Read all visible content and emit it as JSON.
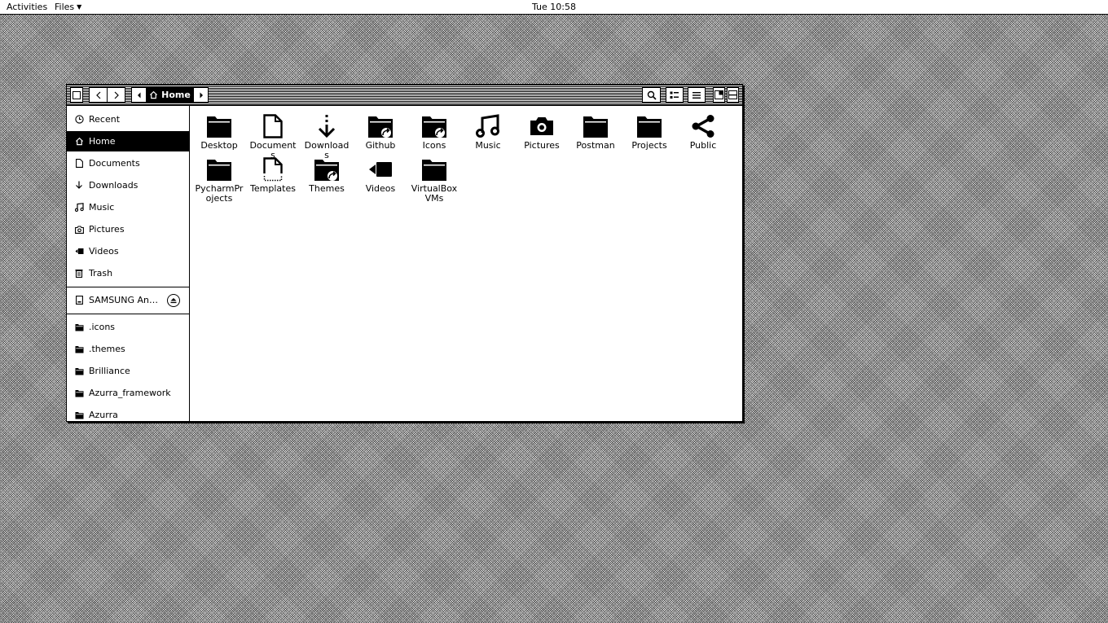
{
  "topbar": {
    "activities": "Activities",
    "app_menu": "Files",
    "clock": "Tue 10:58"
  },
  "headerbar": {
    "breadcrumb_home": "Home",
    "icons": [
      "sidebar-toggle-icon",
      "back-icon",
      "forward-icon",
      "path-left-icon",
      "home-icon",
      "path-right-icon",
      "search-icon",
      "view-options-icon",
      "list-view-icon",
      "window-split-icon",
      "window-maximize-icon"
    ]
  },
  "sidebar": {
    "places": [
      {
        "label": "Recent",
        "icon": "clock-icon"
      },
      {
        "label": "Home",
        "icon": "home-icon",
        "active": true
      },
      {
        "label": "Documents",
        "icon": "document-icon"
      },
      {
        "label": "Downloads",
        "icon": "download-icon"
      },
      {
        "label": "Music",
        "icon": "music-icon"
      },
      {
        "label": "Pictures",
        "icon": "camera-icon"
      },
      {
        "label": "Videos",
        "icon": "video-icon"
      },
      {
        "label": "Trash",
        "icon": "trash-icon"
      }
    ],
    "devices": [
      {
        "label": "SAMSUNG Andr…",
        "icon": "drive-icon"
      }
    ],
    "bookmarks": [
      {
        "label": ".icons",
        "icon": "folder-icon"
      },
      {
        "label": ".themes",
        "icon": "folder-icon"
      },
      {
        "label": "Brilliance",
        "icon": "folder-icon"
      },
      {
        "label": "Azurra_framework",
        "icon": "folder-icon"
      },
      {
        "label": "Azurra",
        "icon": "folder-icon"
      }
    ]
  },
  "files": [
    {
      "name": "Desktop",
      "icon": "folder-icon"
    },
    {
      "name": "Documents",
      "icon": "document-icon"
    },
    {
      "name": "Downloads",
      "icon": "download-icon"
    },
    {
      "name": "Github",
      "icon": "folder-link-icon"
    },
    {
      "name": "Icons",
      "icon": "folder-link-icon"
    },
    {
      "name": "Music",
      "icon": "music-icon"
    },
    {
      "name": "Pictures",
      "icon": "camera-icon"
    },
    {
      "name": "Postman",
      "icon": "folder-icon"
    },
    {
      "name": "Projects",
      "icon": "folder-icon"
    },
    {
      "name": "Public",
      "icon": "share-icon"
    },
    {
      "name": "PycharmPr ojects",
      "icon": "folder-icon"
    },
    {
      "name": "Templates",
      "icon": "template-icon"
    },
    {
      "name": "Themes",
      "icon": "folder-link-icon"
    },
    {
      "name": "Videos",
      "icon": "video-icon"
    },
    {
      "name": "VirtualBox VMs",
      "icon": "folder-icon"
    }
  ]
}
